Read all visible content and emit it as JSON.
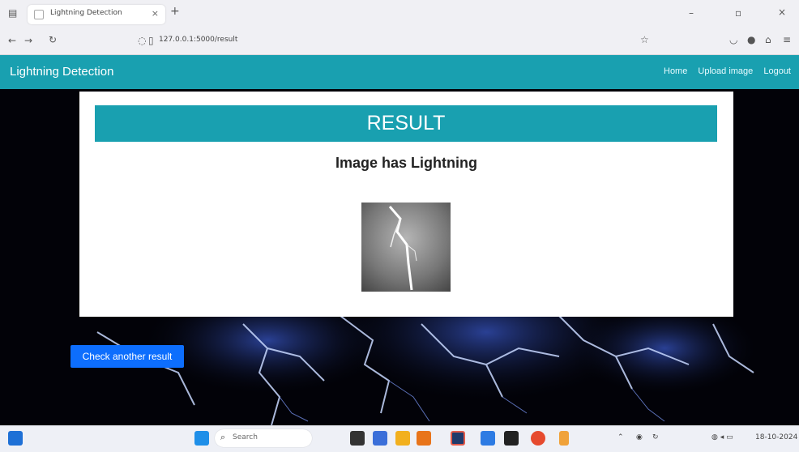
{
  "browser": {
    "tab_title": "Lightning Detection",
    "url": "127.0.0.1:5000/result"
  },
  "app": {
    "brand": "Lightning Detection",
    "nav": [
      "Home",
      "Upload image",
      "Logout"
    ]
  },
  "result": {
    "heading": "RESULT",
    "message": "Image has Lightning",
    "button": "Check another result"
  },
  "taskbar": {
    "search_placeholder": "Search",
    "date": "18-10-2024"
  },
  "colors": {
    "accent": "#19a0b0",
    "button": "#0d6efd"
  }
}
